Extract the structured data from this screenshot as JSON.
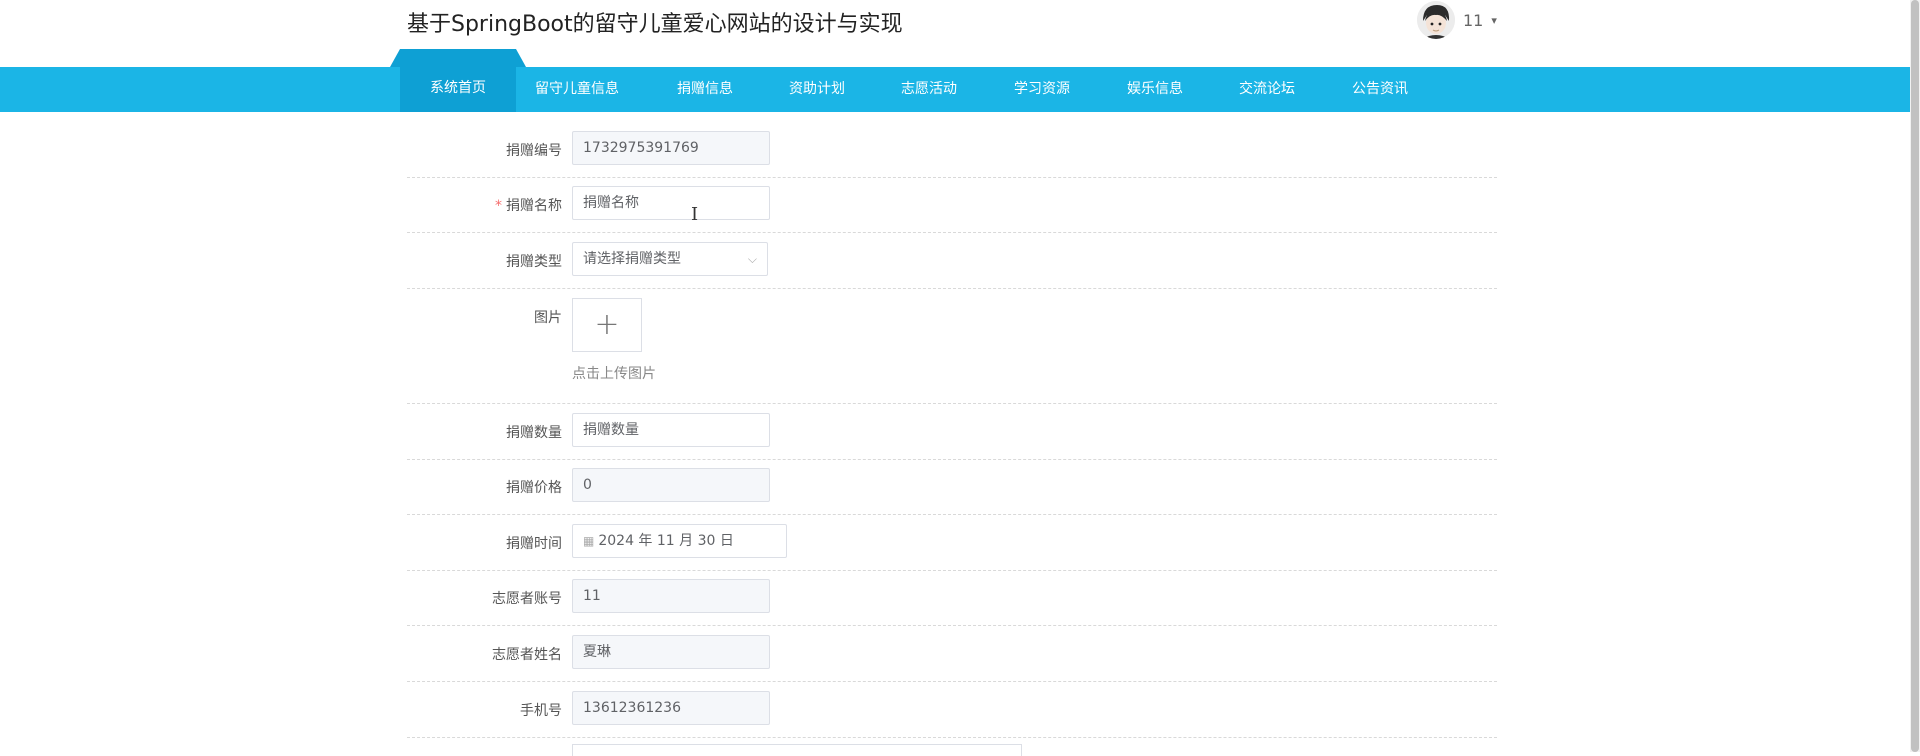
{
  "header": {
    "site_title": "基于SpringBoot的留守儿童爱心网站的设计与实现",
    "username": "11",
    "caret": "▾"
  },
  "nav": {
    "items": [
      "系统首页",
      "留守儿童信息",
      "捐赠信息",
      "资助计划",
      "志愿活动",
      "学习资源",
      "娱乐信息",
      "交流论坛",
      "公告资讯"
    ]
  },
  "form": {
    "donation_no": {
      "label": "捐赠编号",
      "value": "1732975391769"
    },
    "donation_name": {
      "required_mark": "*",
      "label": "捐赠名称",
      "placeholder": "捐赠名称"
    },
    "donation_type": {
      "label": "捐赠类型",
      "placeholder": "请选择捐赠类型",
      "arrow": "⌵"
    },
    "picture": {
      "label": "图片",
      "plus": "+",
      "hint": "点击上传图片"
    },
    "donation_qty": {
      "label": "捐赠数量",
      "placeholder": "捐赠数量"
    },
    "donation_price": {
      "label": "捐赠价格",
      "value": "0"
    },
    "donation_time": {
      "label": "捐赠时间",
      "icon": "▦",
      "value": "2024 年 11 月 30 日"
    },
    "volunteer_account": {
      "label": "志愿者账号",
      "value": "11"
    },
    "volunteer_name": {
      "label": "志愿者姓名",
      "value": "夏琳"
    },
    "phone": {
      "label": "手机号",
      "value": "13612361236"
    }
  },
  "colors": {
    "nav_bg": "#1bb5e6",
    "nav_active": "#0ea0d4"
  },
  "cursor": "I"
}
